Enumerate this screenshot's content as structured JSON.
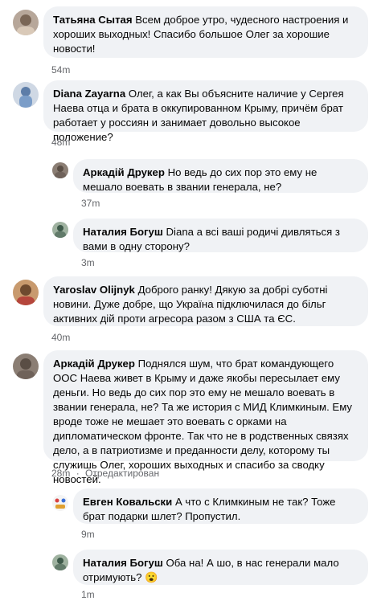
{
  "comments": [
    {
      "author": "Татьяна Сытая",
      "text": "Всем доброе утро, чудесного настроения и хороших выходных! Спасибо большое Олег за хорошие новости!",
      "time": "54m"
    },
    {
      "author": "Diana Zayarna",
      "text": "Олег, а как Вы объясните наличие у Сергея Наева отца и брата в оккупированном Крыму, причём брат работает у россиян и занимает довольно высокое положение?",
      "time": "48m",
      "replies": [
        {
          "author": "Аркадій Друкер",
          "text": "Но ведь до сих пор это ему не мешало воевать в звании генерала, не?",
          "time": "37m"
        },
        {
          "author": "Наталия Богуш",
          "text": "Diana а всі ваші родичі дивляться з вами в одну сторону?",
          "time": "3m"
        }
      ]
    },
    {
      "author": "Yaroslav Olijnyk",
      "text": "Доброго ранку! Дякую за добрі суботні новини. Дуже добре, що Україна підключилася до більг активних дій проти агресора разом з США та ЄС.",
      "time": "40m"
    },
    {
      "author": "Аркадій Друкер",
      "text": "Поднялся шум, что брат командующего ООС Наева живет в Крыму и даже якобы пересылает ему деньги. Но ведь до сих пор это ему не мешало воевать в звании генерала, не? Та же история с МИД Климкиным. Ему вроде тоже не мешает это воевать с орками на дипломатическом фронте. Так что не в родственных связях дело, а в патриотизме и преданности делу, которому ты служишь Олег, хороших выходных и спасибо за сводку новостей.",
      "time": "28m",
      "edited": "Отредактирован",
      "replies": [
        {
          "author": "Евген Ковальски",
          "text": "А что с Климкиным не так? Тоже брат подарки шлет? Пропустил.",
          "time": "9m"
        },
        {
          "author": "Наталия Богуш",
          "text": "Оба на! А шо, в нас генерали мало отримують?",
          "emoji": "😮",
          "time": "1m"
        }
      ]
    }
  ],
  "colors": {
    "bubble": "#f0f2f5",
    "meta": "#65676b",
    "thread": "#e4e6eb"
  }
}
